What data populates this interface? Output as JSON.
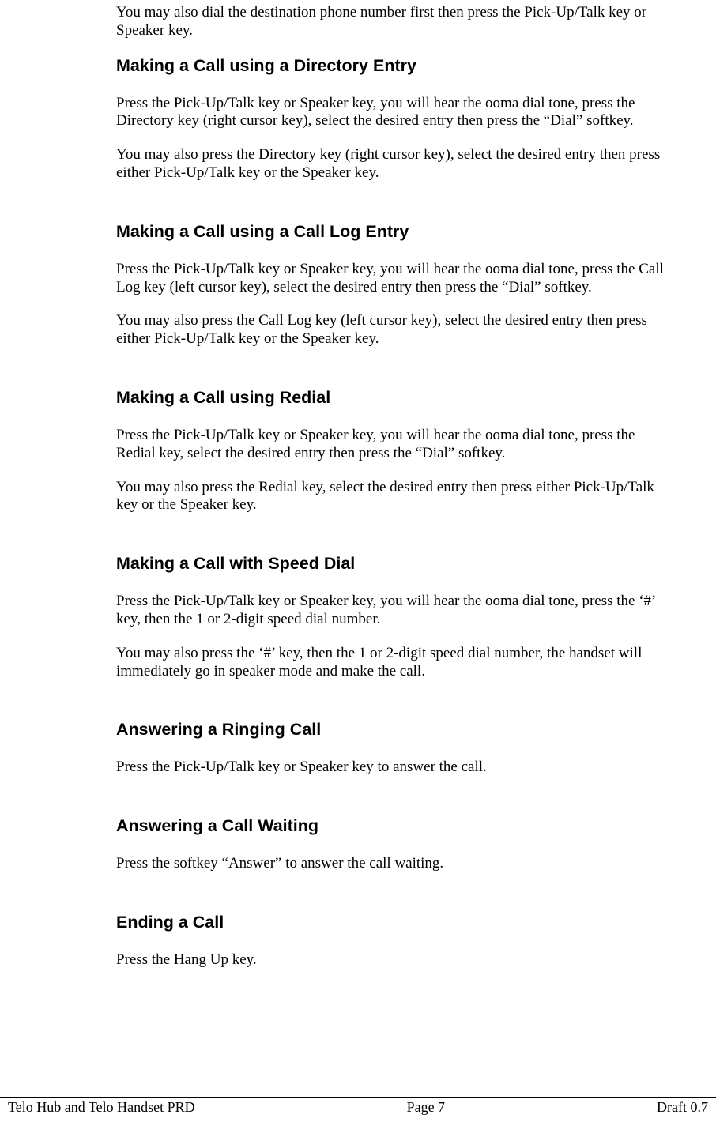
{
  "intro_para": "You may also dial the destination phone number first then press the Pick-Up/Talk key or Speaker key.",
  "sections": [
    {
      "heading": "Making a Call using a Directory Entry",
      "paras": [
        "Press the Pick-Up/Talk key or Speaker key, you will hear the ooma dial tone, press the Directory key (right cursor key), select the desired entry then press the “Dial” softkey.",
        "You may also press the Directory key (right cursor key), select the desired entry then press either Pick-Up/Talk key or the Speaker key."
      ]
    },
    {
      "heading": "Making a Call using a Call Log Entry",
      "paras": [
        "Press the Pick-Up/Talk key or Speaker key, you will hear the ooma dial tone, press the Call Log key (left cursor key), select the desired entry then press the “Dial” softkey.",
        "You may also press the Call Log key (left cursor key), select the desired entry then press either Pick-Up/Talk key or the Speaker key."
      ]
    },
    {
      "heading": "Making a Call using Redial",
      "paras": [
        "Press the Pick-Up/Talk key or Speaker key, you will hear the ooma dial tone, press the Redial key, select the desired entry then press the “Dial” softkey.",
        "You may also press the Redial key, select the desired entry then press either Pick-Up/Talk key or the Speaker key."
      ]
    },
    {
      "heading": "Making a Call with Speed Dial",
      "paras": [
        "Press the Pick-Up/Talk key or Speaker key, you will hear the ooma dial tone, press the ‘#’ key, then the 1 or 2-digit speed dial number.",
        "You may also press the ‘#’ key, then the 1 or 2-digit speed dial number, the handset will immediately go in speaker mode and make the call."
      ]
    },
    {
      "heading": "Answering a Ringing Call",
      "paras": [
        "Press the Pick-Up/Talk key or Speaker key to answer the call."
      ]
    },
    {
      "heading": "Answering a Call Waiting",
      "paras": [
        "Press the softkey “Answer” to answer the call waiting."
      ]
    },
    {
      "heading": "Ending a Call",
      "paras": [
        "Press the Hang Up key."
      ]
    }
  ],
  "footer": {
    "left": "Telo Hub and Telo Handset  PRD",
    "center": "Page 7",
    "right": "Draft 0.7"
  }
}
